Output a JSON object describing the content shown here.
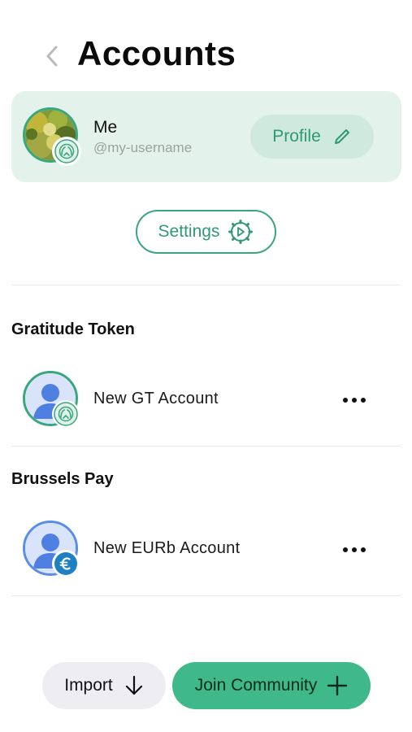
{
  "header": {
    "title": "Accounts",
    "back_icon": "chevron-left-icon"
  },
  "me": {
    "name": "Me",
    "username": "@my-username",
    "badge_icon": "gratitude-hands-icon",
    "profile_label": "Profile",
    "profile_icon": "pencil-icon"
  },
  "settings": {
    "label": "Settings",
    "icon": "gear-icon"
  },
  "communities": [
    {
      "title": "Gratitude Token",
      "accounts": [
        {
          "name": "New GT Account",
          "badge_icon": "gratitude-hands-icon",
          "more_icon": "ellipsis-icon"
        }
      ]
    },
    {
      "title": "Brussels Pay",
      "accounts": [
        {
          "name": "New EURb Account",
          "badge_icon": "euro-icon",
          "more_icon": "ellipsis-icon"
        }
      ]
    }
  ],
  "bottom": {
    "import_label": "Import",
    "import_icon": "arrow-down-icon",
    "join_label": "Join Community",
    "join_icon": "plus-icon"
  },
  "colors": {
    "accent": "#3aa67e",
    "card_bg": "#e4f2ec",
    "profile_btn_bg": "#cfe9df",
    "join_btn_bg": "#3fb98a",
    "import_btn_bg": "#eeeef2",
    "euro_badge": "#1e7fc2"
  }
}
